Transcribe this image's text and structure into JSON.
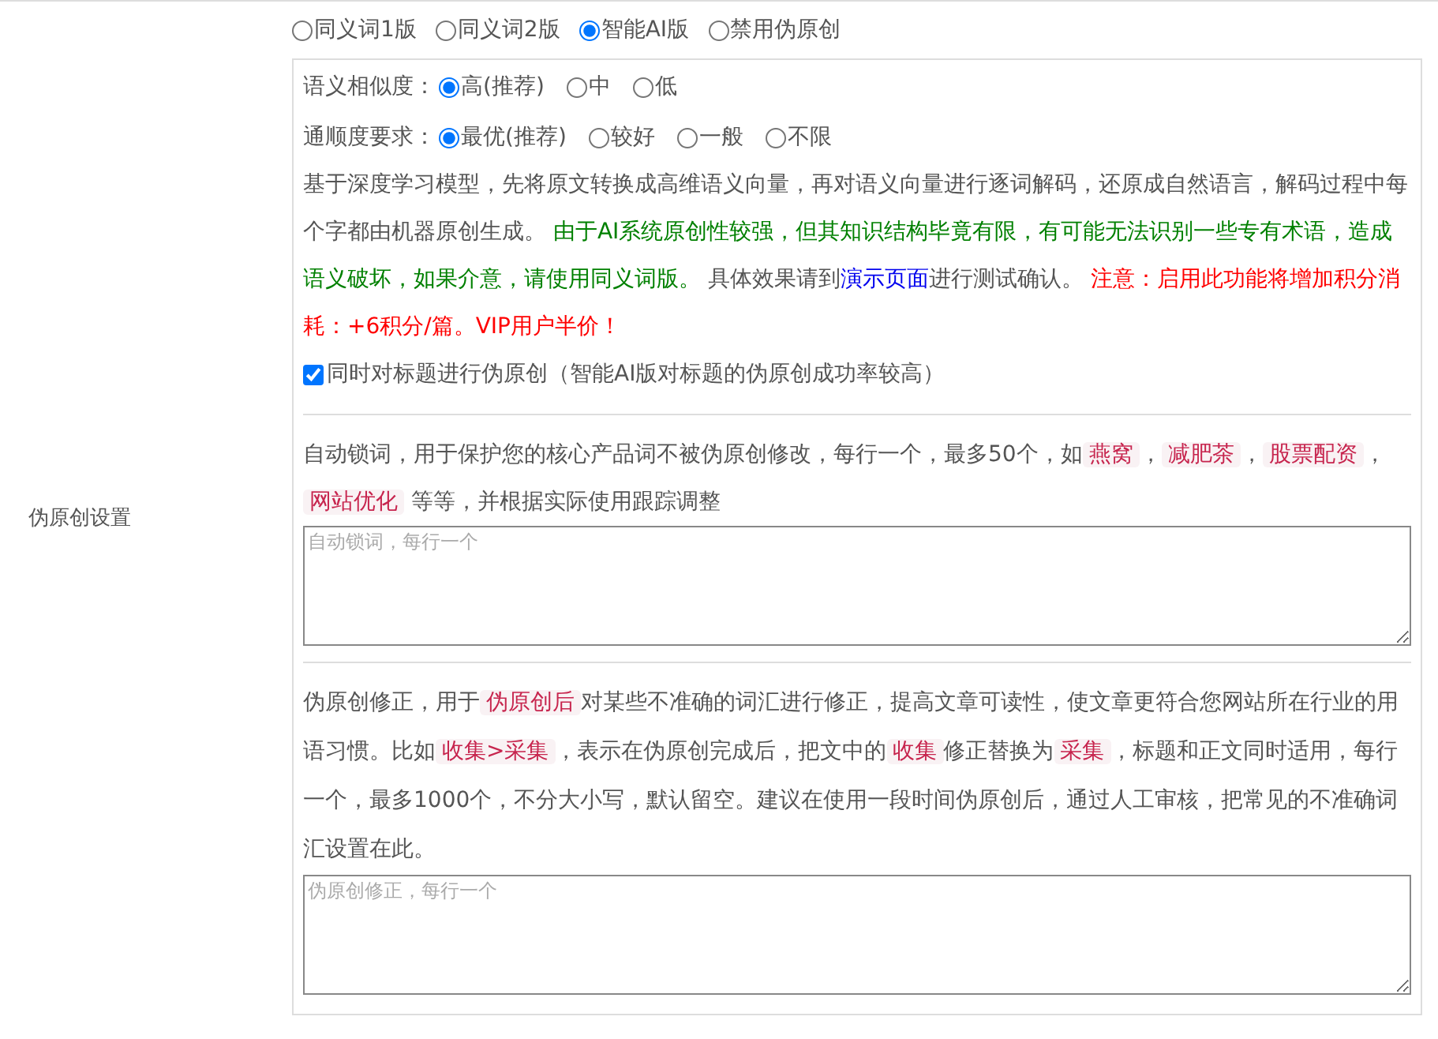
{
  "modes": [
    {
      "label": "同义词1版",
      "selected": false
    },
    {
      "label": "同义词2版",
      "selected": false
    },
    {
      "label": "智能AI版",
      "selected": true
    },
    {
      "label": "禁用伪原创",
      "selected": false
    }
  ],
  "ai_panel": {
    "option_groups": [
      {
        "label": "语义相似度：",
        "options": [
          {
            "label": "高(推荐)",
            "selected": true
          },
          {
            "label": "中",
            "selected": false
          },
          {
            "label": "低",
            "selected": false
          }
        ]
      },
      {
        "label": "通顺度要求：",
        "options": [
          {
            "label": "最优(推荐)",
            "selected": true
          },
          {
            "label": "较好",
            "selected": false
          },
          {
            "label": "一般",
            "selected": false
          },
          {
            "label": "不限",
            "selected": false
          }
        ]
      }
    ],
    "description": [
      {
        "kind": "text",
        "text": "基于深度学习模型，先将原文转换成高维语义向量，再对语义向量进行逐词解码，还原成自然语言，解码过程中每个字都由机器原创生成。 "
      },
      {
        "kind": "green",
        "text": "由于AI系统原创性较强，但其知识结构毕竟有限，有可能无法识别一些专有术语，造成语义破坏，如果介意，请使用同义词版。"
      },
      {
        "kind": "text",
        "text": " 具体效果请到"
      },
      {
        "kind": "link",
        "text": "演示页面"
      },
      {
        "kind": "text",
        "text": "进行测试确认。 "
      },
      {
        "kind": "red",
        "text": "注意：启用此功能将增加积分消耗：+6积分/篇。VIP用户半价！"
      }
    ],
    "title_option": {
      "label": "同时对标题进行伪原创（智能AI版对标题的伪原创成功率较高）",
      "checked": true
    }
  },
  "settings_label": "伪原创设置",
  "lock_words": {
    "description": [
      {
        "kind": "text",
        "text": "自动锁词，用于保护您的核心产品词不被伪原创修改，每行一个，最多50个，如"
      },
      {
        "kind": "code",
        "text": "燕窝"
      },
      {
        "kind": "text",
        "text": "，"
      },
      {
        "kind": "code",
        "text": "减肥茶"
      },
      {
        "kind": "text",
        "text": "，"
      },
      {
        "kind": "code",
        "text": "股票配资"
      },
      {
        "kind": "text",
        "text": "，"
      },
      {
        "kind": "code",
        "text": "网站优化"
      },
      {
        "kind": "text",
        "text": " 等等，并根据实际使用跟踪调整"
      }
    ],
    "placeholder": "自动锁词，每行一个"
  },
  "corrections": {
    "description": [
      {
        "kind": "text",
        "text": "伪原创修正，用于"
      },
      {
        "kind": "code",
        "text": "伪原创后"
      },
      {
        "kind": "text",
        "text": "对某些不准确的词汇进行修正，提高文章可读性，使文章更符合您网站所在行业的用语习惯。比如"
      },
      {
        "kind": "code",
        "text": "收集>采集"
      },
      {
        "kind": "text",
        "text": "，表示在伪原创完成后，把文中的"
      },
      {
        "kind": "code",
        "text": "收集"
      },
      {
        "kind": "text",
        "text": "修正替换为"
      },
      {
        "kind": "code",
        "text": "采集"
      },
      {
        "kind": "text",
        "text": "，标题和正文同时适用，每行一个，最多1000个，不分大小写，默认留空。建议在使用一段时间伪原创后，通过人工审核，把常见的不准确词汇设置在此。"
      }
    ],
    "placeholder": "伪原创修正，每行一个"
  }
}
